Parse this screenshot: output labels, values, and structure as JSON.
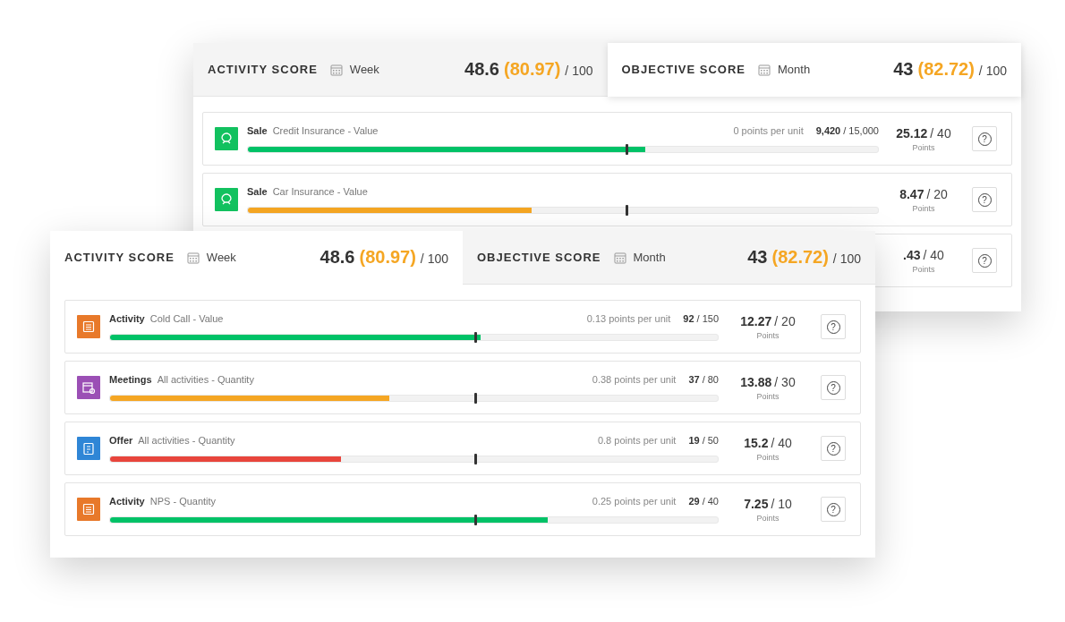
{
  "back_panel": {
    "tabs": [
      {
        "title": "ACTIVITY SCORE",
        "period": "Week",
        "score": "48.6",
        "adjusted": "(80.97)",
        "max": "/ 100",
        "selected": false
      },
      {
        "title": "OBJECTIVE SCORE",
        "period": "Month",
        "score": "43",
        "adjusted": "(82.72)",
        "max": "/ 100",
        "selected": true
      }
    ],
    "rows": [
      {
        "kind": "sale",
        "category": "Sale",
        "name": "Credit Insurance - Value",
        "color": "#00c267",
        "level": 0.63,
        "per_unit": "0 points per unit",
        "count": "9,420",
        "target": "/ 15,000",
        "points": "25.12",
        "points_max": "/ 40",
        "points_label": "Points",
        "help": "?"
      },
      {
        "kind": "sale",
        "category": "Sale",
        "name": "Car Insurance - Value",
        "color": "#f5a623",
        "level": 0.45,
        "points": "8.47",
        "points_max": "/ 20",
        "points_label": "Points",
        "help": "?"
      },
      {
        "points": ".43",
        "points_max": "/ 40",
        "points_label": "Points",
        "help": "?"
      }
    ]
  },
  "front_panel": {
    "tabs": [
      {
        "title": "ACTIVITY SCORE",
        "period": "Week",
        "score": "48.6",
        "adjusted": "(80.97)",
        "max": "/ 100",
        "selected": true
      },
      {
        "title": "OBJECTIVE SCORE",
        "period": "Month",
        "score": "43",
        "adjusted": "(82.72)",
        "max": "/ 100",
        "selected": false
      }
    ],
    "rows": [
      {
        "kind": "activity",
        "category": "Activity",
        "name": "Cold Call - Value",
        "color": "#00c267",
        "level": 0.61,
        "per_unit": "0.13 points per unit",
        "count": "92",
        "target": "/ 150",
        "points": "12.27",
        "points_max": "/ 20",
        "points_label": "Points",
        "help": "?"
      },
      {
        "kind": "meetings",
        "category": "Meetings",
        "name": "All activities - Quantity",
        "color": "#f5a623",
        "level": 0.46,
        "per_unit": "0.38 points per unit",
        "count": "37",
        "target": "/ 80",
        "points": "13.88",
        "points_max": "/ 30",
        "points_label": "Points",
        "help": "?"
      },
      {
        "kind": "offer",
        "category": "Offer",
        "name": "All activities - Quantity",
        "color": "#e8453c",
        "level": 0.38,
        "per_unit": "0.8 points per unit",
        "count": "19",
        "target": "/ 50",
        "points": "15.2",
        "points_max": "/ 40",
        "points_label": "Points",
        "help": "?"
      },
      {
        "kind": "activity",
        "category": "Activity",
        "name": "NPS - Quantity",
        "color": "#00c267",
        "level": 0.72,
        "per_unit": "0.25 points per unit",
        "count": "29",
        "target": "/ 40",
        "points": "7.25",
        "points_max": "/ 10",
        "points_label": "Points",
        "help": "?"
      }
    ]
  }
}
